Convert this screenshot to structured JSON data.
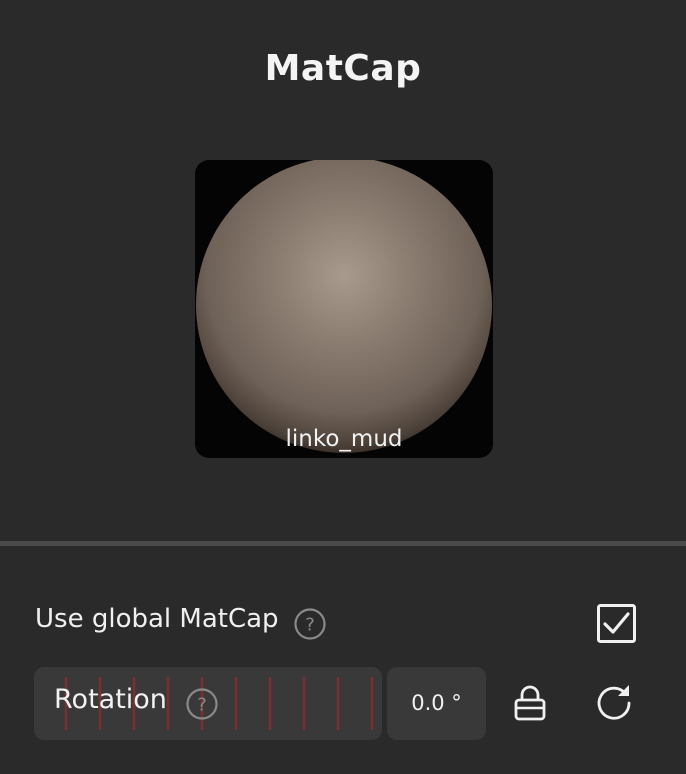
{
  "panel": {
    "title": "MatCap"
  },
  "matcap": {
    "name": "linko_mud",
    "sphere_color": "#8a7b6f",
    "background_color": "#050404"
  },
  "use_global": {
    "label": "Use global MatCap",
    "checked": true,
    "help_icon": "question-circle-icon"
  },
  "rotation": {
    "label": "Rotation",
    "value": "0.0 °",
    "help_icon": "question-circle-icon",
    "lock_icon": "lock-icon",
    "reset_icon": "reset-icon"
  },
  "colors": {
    "background": "#2b2a2b",
    "field_background": "#3a3939",
    "divider": "#4c4b4c",
    "slider_ticks": "#7a3032"
  }
}
